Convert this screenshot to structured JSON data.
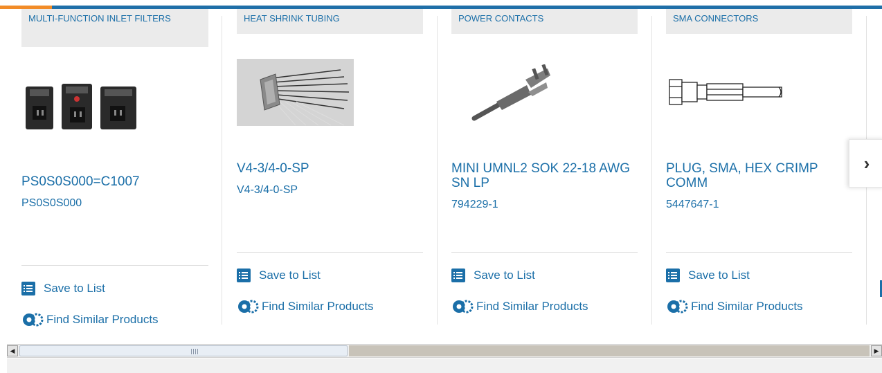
{
  "cards": [
    {
      "category": "MULTI-FUNCTION INLET FILTERS",
      "product_name": "PS0S0S000=C1007",
      "part_number": "PS0S0S000",
      "image_icon": "inlet-filter-image",
      "save_label": "Save to List",
      "similar_label": "Find Similar Products"
    },
    {
      "category": "HEAT SHRINK TUBING",
      "product_name": "V4-3/4-0-SP",
      "part_number": "V4-3/4-0-SP",
      "image_icon": "heat-shrink-tubing-image",
      "save_label": "Save to List",
      "similar_label": "Find Similar Products"
    },
    {
      "category": "POWER CONTACTS",
      "product_name": "MINI UMNL2 SOK 22-18 AWG SN LP",
      "part_number": "794229-1",
      "image_icon": "power-contact-image",
      "save_label": "Save to List",
      "similar_label": "Find Similar Products"
    },
    {
      "category": "SMA CONNECTORS",
      "product_name": "PLUG, SMA, HEX CRIMP COMM",
      "part_number": "5447647-1",
      "image_icon": "sma-connector-image",
      "save_label": "Save to List",
      "similar_label": "Find Similar Products"
    }
  ],
  "next_button": {
    "glyph": "›",
    "icon": "chevron-right-icon"
  },
  "scrollbar": {
    "left_arrow": "◀",
    "right_arrow": "▶"
  },
  "colors": {
    "link": "#1b6fa8",
    "accent": "#f28c28",
    "top_bar": "#1f6fa8"
  }
}
